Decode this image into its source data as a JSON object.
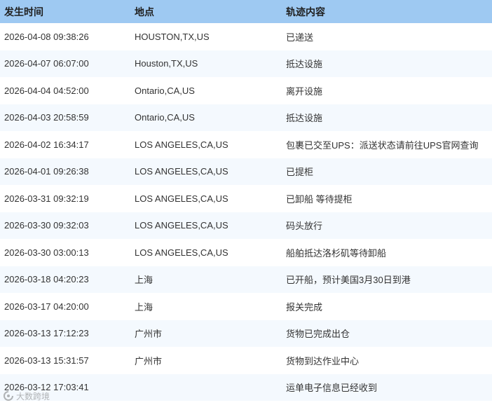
{
  "table": {
    "headers": [
      "发生时间",
      "地点",
      "轨迹内容"
    ],
    "rows": [
      {
        "time": "2026-04-08 09:38:26",
        "place": "HOUSTON,TX,US",
        "content": "已递送"
      },
      {
        "time": "2026-04-07 06:07:00",
        "place": "Houston,TX,US",
        "content": "抵达设施"
      },
      {
        "time": "2026-04-04 04:52:00",
        "place": "Ontario,CA,US",
        "content": "离开设施"
      },
      {
        "time": "2026-04-03 20:58:59",
        "place": "Ontario,CA,US",
        "content": "抵达设施"
      },
      {
        "time": "2026-04-02 16:34:17",
        "place": "LOS ANGELES,CA,US",
        "content": "包裹已交至UPS：派送状态请前往UPS官网查询"
      },
      {
        "time": "2026-04-01 09:26:38",
        "place": "LOS ANGELES,CA,US",
        "content": "已提柜"
      },
      {
        "time": "2026-03-31 09:32:19",
        "place": "LOS ANGELES,CA,US",
        "content": "已卸船 等待提柜"
      },
      {
        "time": "2026-03-30 09:32:03",
        "place": "LOS ANGELES,CA,US",
        "content": "码头放行"
      },
      {
        "time": "2026-03-30 03:00:13",
        "place": "LOS ANGELES,CA,US",
        "content": "船舶抵达洛杉矶等待卸船"
      },
      {
        "time": "2026-03-18 04:20:23",
        "place": "上海",
        "content": "已开船，预计美国3月30日到港"
      },
      {
        "time": "2026-03-17 04:20:00",
        "place": "上海",
        "content": "报关完成"
      },
      {
        "time": "2026-03-13 17:12:23",
        "place": "广州市",
        "content": "货物已完成出仓"
      },
      {
        "time": "2026-03-13 15:31:57",
        "place": "广州市",
        "content": "货物到达作业中心"
      },
      {
        "time": "2026-03-12 17:03:41",
        "place": "",
        "content": "运单电子信息已经收到"
      }
    ]
  },
  "watermark": {
    "text": "大数跨境",
    "icon": "logo-icon"
  },
  "colors": {
    "header_bg": "#9ec9f2",
    "stripe_bg": "#f4f9fe"
  }
}
